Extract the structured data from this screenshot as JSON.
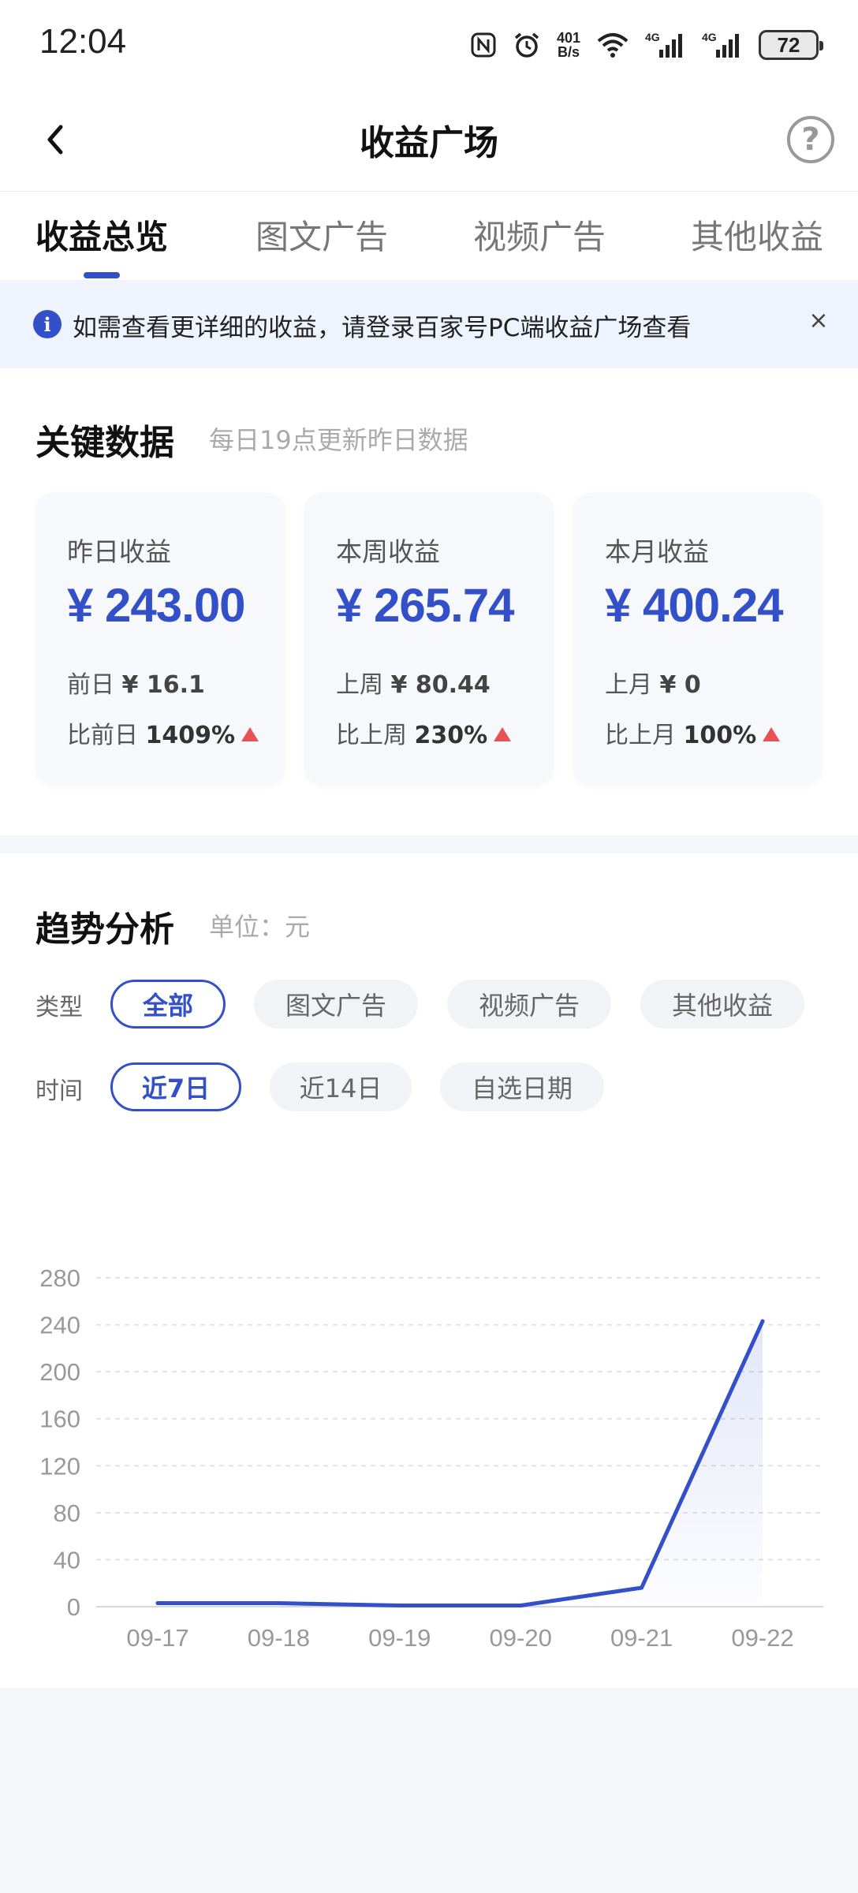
{
  "status_bar": {
    "time": "12:04",
    "net_speed_value": "401",
    "net_speed_unit": "B/s",
    "battery": "72"
  },
  "nav": {
    "title": "收益广场"
  },
  "tabs": [
    {
      "label": "收益总览",
      "active": true
    },
    {
      "label": "图文广告",
      "active": false
    },
    {
      "label": "视频广告",
      "active": false
    },
    {
      "label": "其他收益",
      "active": false
    }
  ],
  "notice": {
    "text": "如需查看更详细的收益，请登录百家号PC端收益广场查看",
    "close": "×"
  },
  "key_data": {
    "title": "关键数据",
    "subtitle": "每日19点更新昨日数据",
    "cards": [
      {
        "label": "昨日收益",
        "value": "¥ 243.00",
        "prev_label": "前日",
        "prev_value": "¥ 16.1",
        "compare_label": "比前日",
        "compare_value": "1409%"
      },
      {
        "label": "本周收益",
        "value": "¥ 265.74",
        "prev_label": "上周",
        "prev_value": "¥ 80.44",
        "compare_label": "比上周",
        "compare_value": "230%"
      },
      {
        "label": "本月收益",
        "value": "¥ 400.24",
        "prev_label": "上月",
        "prev_value": "¥ 0",
        "compare_label": "比上月",
        "compare_value": "100%"
      }
    ]
  },
  "trend": {
    "title": "趋势分析",
    "unit": "单位：元",
    "type_label": "类型",
    "type_options": [
      "全部",
      "图文广告",
      "视频广告",
      "其他收益"
    ],
    "type_selected": "全部",
    "time_label": "时间",
    "time_options": [
      "近7日",
      "近14日",
      "自选日期"
    ],
    "time_selected": "近7日"
  },
  "chart_data": {
    "type": "area",
    "x": [
      "09-17",
      "09-18",
      "09-19",
      "09-20",
      "09-21",
      "09-22"
    ],
    "series": [
      {
        "values": [
          3,
          3,
          1,
          1,
          16.1,
          243
        ]
      }
    ],
    "yticks": [
      0,
      40,
      80,
      120,
      160,
      200,
      240,
      280
    ],
    "ylim": [
      0,
      280
    ],
    "grid": true,
    "line_color": "#3350c8"
  },
  "colors": {
    "accent": "#3350c8",
    "up": "#e85252"
  }
}
